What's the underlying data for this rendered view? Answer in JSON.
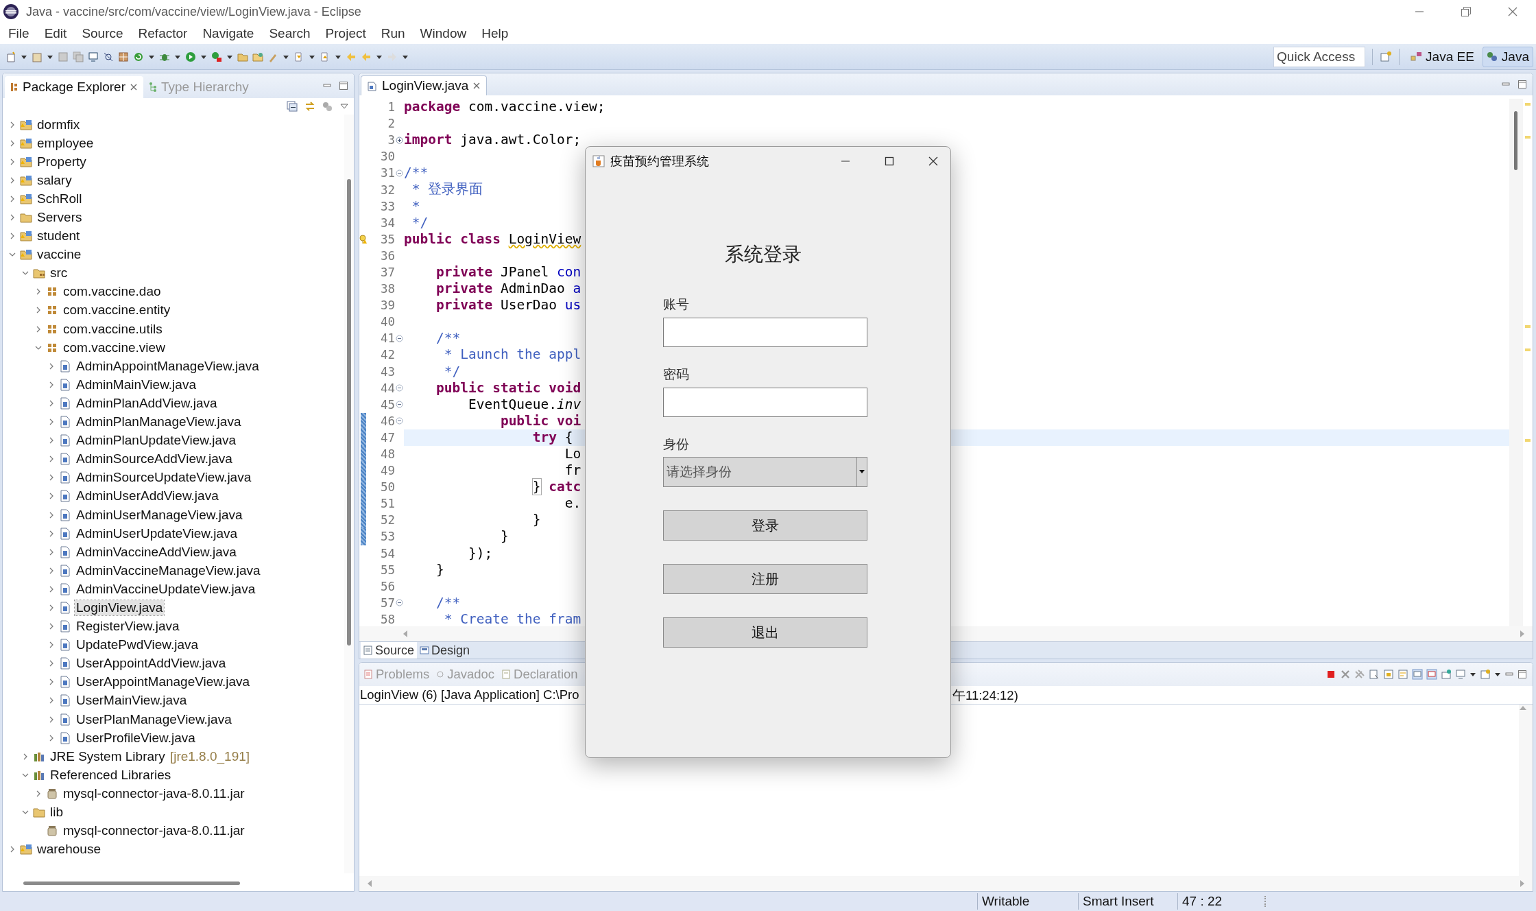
{
  "window": {
    "title": "Java - vaccine/src/com/vaccine/view/LoginView.java - Eclipse"
  },
  "menu": [
    "File",
    "Edit",
    "Source",
    "Refactor",
    "Navigate",
    "Search",
    "Project",
    "Run",
    "Window",
    "Help"
  ],
  "quick_access": {
    "placeholder": "Quick Access"
  },
  "perspectives": [
    {
      "label": "Java EE",
      "kind": "javaee",
      "selected": false
    },
    {
      "label": "Java",
      "kind": "java",
      "selected": true
    }
  ],
  "explorer": {
    "tabs": [
      {
        "label": "Package Explorer",
        "kind": "packages",
        "selected": true
      },
      {
        "label": "Type Hierarchy",
        "kind": "hierarchy",
        "selected": false
      }
    ],
    "tree": [
      {
        "label": "dormfix",
        "kind": "project",
        "expanded": false,
        "selected": false
      },
      {
        "label": "employee",
        "kind": "project",
        "expanded": false,
        "selected": false
      },
      {
        "label": "Property",
        "kind": "project",
        "expanded": false,
        "selected": false
      },
      {
        "label": "salary",
        "kind": "project",
        "expanded": false,
        "selected": false
      },
      {
        "label": "SchRoll",
        "kind": "project",
        "expanded": false,
        "selected": false
      },
      {
        "label": "Servers",
        "kind": "folder",
        "expanded": false,
        "selected": false
      },
      {
        "label": "student",
        "kind": "project",
        "expanded": false,
        "selected": false
      },
      {
        "label": "vaccine",
        "kind": "project",
        "expanded": true,
        "selected": false,
        "children": [
          {
            "label": "src",
            "kind": "source-folder",
            "expanded": true,
            "selected": false,
            "children": [
              {
                "label": "com.vaccine.dao",
                "kind": "package",
                "expanded": false,
                "selected": false
              },
              {
                "label": "com.vaccine.entity",
                "kind": "package",
                "expanded": false,
                "selected": false
              },
              {
                "label": "com.vaccine.utils",
                "kind": "package",
                "expanded": false,
                "selected": false
              },
              {
                "label": "com.vaccine.view",
                "kind": "package",
                "expanded": true,
                "selected": false,
                "children": [
                  {
                    "label": "AdminAppointManageView.java",
                    "kind": "java-file",
                    "expanded": false,
                    "selected": false
                  },
                  {
                    "label": "AdminMainView.java",
                    "kind": "java-file",
                    "expanded": false,
                    "selected": false
                  },
                  {
                    "label": "AdminPlanAddView.java",
                    "kind": "java-file",
                    "expanded": false,
                    "selected": false
                  },
                  {
                    "label": "AdminPlanManageView.java",
                    "kind": "java-file",
                    "expanded": false,
                    "selected": false
                  },
                  {
                    "label": "AdminPlanUpdateView.java",
                    "kind": "java-file",
                    "expanded": false,
                    "selected": false
                  },
                  {
                    "label": "AdminSourceAddView.java",
                    "kind": "java-file",
                    "expanded": false,
                    "selected": false
                  },
                  {
                    "label": "AdminSourceUpdateView.java",
                    "kind": "java-file",
                    "expanded": false,
                    "selected": false
                  },
                  {
                    "label": "AdminUserAddView.java",
                    "kind": "java-file",
                    "expanded": false,
                    "selected": false
                  },
                  {
                    "label": "AdminUserManageView.java",
                    "kind": "java-file",
                    "expanded": false,
                    "selected": false
                  },
                  {
                    "label": "AdminUserUpdateView.java",
                    "kind": "java-file",
                    "expanded": false,
                    "selected": false
                  },
                  {
                    "label": "AdminVaccineAddView.java",
                    "kind": "java-file",
                    "expanded": false,
                    "selected": false
                  },
                  {
                    "label": "AdminVaccineManageView.java",
                    "kind": "java-file",
                    "expanded": false,
                    "selected": false
                  },
                  {
                    "label": "AdminVaccineUpdateView.java",
                    "kind": "java-file",
                    "expanded": false,
                    "selected": false
                  },
                  {
                    "label": "LoginView.java",
                    "kind": "java-file",
                    "expanded": false,
                    "selected": true
                  },
                  {
                    "label": "RegisterView.java",
                    "kind": "java-file",
                    "expanded": false,
                    "selected": false
                  },
                  {
                    "label": "UpdatePwdView.java",
                    "kind": "java-file",
                    "expanded": false,
                    "selected": false
                  },
                  {
                    "label": "UserAppointAddView.java",
                    "kind": "java-file",
                    "expanded": false,
                    "selected": false
                  },
                  {
                    "label": "UserAppointManageView.java",
                    "kind": "java-file",
                    "expanded": false,
                    "selected": false
                  },
                  {
                    "label": "UserMainView.java",
                    "kind": "java-file",
                    "expanded": false,
                    "selected": false
                  },
                  {
                    "label": "UserPlanManageView.java",
                    "kind": "java-file",
                    "expanded": false,
                    "selected": false
                  },
                  {
                    "label": "UserProfileView.java",
                    "kind": "java-file",
                    "expanded": false,
                    "selected": false
                  }
                ]
              }
            ]
          },
          {
            "label": "JRE System Library",
            "decoration": "[jre1.8.0_191]",
            "kind": "library",
            "expanded": false,
            "selected": false
          },
          {
            "label": "Referenced Libraries",
            "kind": "library",
            "expanded": true,
            "selected": false,
            "children": [
              {
                "label": "mysql-connector-java-8.0.11.jar",
                "kind": "jar",
                "expanded": false,
                "selected": false
              }
            ]
          },
          {
            "label": "lib",
            "kind": "folder",
            "expanded": true,
            "selected": false,
            "children": [
              {
                "label": "mysql-connector-java-8.0.11.jar",
                "kind": "jar",
                "selected": false
              }
            ]
          }
        ]
      },
      {
        "label": "warehouse",
        "kind": "project",
        "expanded": false,
        "selected": false
      }
    ]
  },
  "editor": {
    "tabs": [
      {
        "label": "LoginView.java",
        "selected": true
      }
    ],
    "lines": [
      {
        "n": "1",
        "current": false,
        "in_range": false,
        "warning": false,
        "segments": [
          {
            "kind": "kw",
            "text": "package"
          },
          {
            "kind": "plain",
            "text": " com.vaccine.view;"
          }
        ]
      },
      {
        "n": "2",
        "current": false,
        "in_range": false,
        "warning": false
      },
      {
        "n": "3",
        "current": false,
        "in_range": false,
        "warning": false,
        "folded": true,
        "segments": [
          {
            "kind": "kw",
            "text": "import"
          },
          {
            "kind": "plain",
            "text": " java.awt.Color;"
          }
        ]
      },
      {
        "n": "30",
        "current": false,
        "in_range": false,
        "warning": false
      },
      {
        "n": "31",
        "current": false,
        "in_range": false,
        "warning": false,
        "folded": false,
        "segments": [
          {
            "kind": "comment",
            "text": "/**"
          }
        ]
      },
      {
        "n": "32",
        "current": false,
        "in_range": false,
        "warning": false,
        "segments": [
          {
            "kind": "comment",
            "text": " * 登录界面"
          }
        ]
      },
      {
        "n": "33",
        "current": false,
        "in_range": false,
        "warning": false,
        "segments": [
          {
            "kind": "comment",
            "text": " *"
          }
        ]
      },
      {
        "n": "34",
        "current": false,
        "in_range": false,
        "warning": false,
        "segments": [
          {
            "kind": "comment",
            "text": " */"
          }
        ]
      },
      {
        "n": "35",
        "current": false,
        "in_range": false,
        "warning": true,
        "segments": [
          {
            "kind": "kw",
            "text": "public class"
          },
          {
            "kind": "warn",
            "text": " LoginView"
          }
        ]
      },
      {
        "n": "36",
        "current": false,
        "in_range": false,
        "warning": false
      },
      {
        "n": "37",
        "current": false,
        "in_range": false,
        "warning": false,
        "segments": [
          {
            "kind": "kw",
            "text": "    private"
          },
          {
            "kind": "plain",
            "text": " JPanel "
          },
          {
            "kind": "field",
            "text": "con"
          }
        ]
      },
      {
        "n": "38",
        "current": false,
        "in_range": false,
        "warning": false,
        "segments": [
          {
            "kind": "kw",
            "text": "    private"
          },
          {
            "kind": "plain",
            "text": " AdminDao "
          },
          {
            "kind": "field",
            "text": "a"
          }
        ]
      },
      {
        "n": "39",
        "current": false,
        "in_range": false,
        "warning": false,
        "segments": [
          {
            "kind": "kw",
            "text": "    private"
          },
          {
            "kind": "plain",
            "text": " UserDao "
          },
          {
            "kind": "field",
            "text": "us"
          }
        ]
      },
      {
        "n": "40",
        "current": false,
        "in_range": false,
        "warning": false
      },
      {
        "n": "41",
        "current": false,
        "in_range": false,
        "warning": false,
        "folded": false,
        "segments": [
          {
            "kind": "comment",
            "text": "    /**"
          }
        ]
      },
      {
        "n": "42",
        "current": false,
        "in_range": false,
        "warning": false,
        "segments": [
          {
            "kind": "comment",
            "text": "     * Launch the appl"
          }
        ]
      },
      {
        "n": "43",
        "current": false,
        "in_range": false,
        "warning": false,
        "segments": [
          {
            "kind": "comment",
            "text": "     */"
          }
        ]
      },
      {
        "n": "44",
        "current": false,
        "in_range": false,
        "warning": false,
        "folded": false,
        "segments": [
          {
            "kind": "kw",
            "text": "    public static void"
          }
        ]
      },
      {
        "n": "45",
        "current": false,
        "in_range": false,
        "warning": false,
        "folded": false,
        "segments": [
          {
            "kind": "plain",
            "text": "        EventQueue."
          },
          {
            "kind": "italic",
            "text": "inv"
          }
        ]
      },
      {
        "n": "46",
        "current": false,
        "in_range": true,
        "warning": false,
        "folded": false,
        "segments": [
          {
            "kind": "kw",
            "text": "            public voi"
          }
        ]
      },
      {
        "n": "47",
        "current": true,
        "in_range": true,
        "warning": false,
        "segments": [
          {
            "kind": "kw",
            "text": "                try"
          },
          {
            "kind": "plain",
            "text": " {"
          }
        ]
      },
      {
        "n": "48",
        "current": false,
        "in_range": true,
        "warning": false,
        "segments": [
          {
            "kind": "plain",
            "text": "                    Lo"
          }
        ]
      },
      {
        "n": "49",
        "current": false,
        "in_range": true,
        "warning": false,
        "segments": [
          {
            "kind": "plain",
            "text": "                    fr"
          }
        ]
      },
      {
        "n": "50",
        "current": false,
        "in_range": true,
        "warning": false,
        "segments": [
          {
            "kind": "bracket",
            "text": "                }"
          },
          {
            "kind": "kw",
            "text": " catc"
          }
        ]
      },
      {
        "n": "51",
        "current": false,
        "in_range": true,
        "warning": false,
        "segments": [
          {
            "kind": "plain",
            "text": "                    e."
          }
        ]
      },
      {
        "n": "52",
        "current": false,
        "in_range": true,
        "warning": false,
        "segments": [
          {
            "kind": "plain",
            "text": "                }"
          }
        ]
      },
      {
        "n": "53",
        "current": false,
        "in_range": true,
        "warning": false,
        "segments": [
          {
            "kind": "plain",
            "text": "            }"
          }
        ]
      },
      {
        "n": "54",
        "current": false,
        "in_range": false,
        "warning": false,
        "segments": [
          {
            "kind": "plain",
            "text": "        });"
          }
        ]
      },
      {
        "n": "55",
        "current": false,
        "in_range": false,
        "warning": false,
        "segments": [
          {
            "kind": "plain",
            "text": "    }"
          }
        ]
      },
      {
        "n": "56",
        "current": false,
        "in_range": false,
        "warning": false
      },
      {
        "n": "57",
        "current": false,
        "in_range": false,
        "warning": false,
        "folded": false,
        "segments": [
          {
            "kind": "comment",
            "text": "    /**"
          }
        ]
      },
      {
        "n": "58",
        "current": false,
        "in_range": false,
        "warning": false,
        "segments": [
          {
            "kind": "comment",
            "text": "     * Create the fram"
          }
        ]
      }
    ],
    "bottom_tabs": [
      {
        "label": "Source",
        "kind": "source",
        "selected": true
      },
      {
        "label": "Design",
        "kind": "design",
        "selected": false
      }
    ]
  },
  "console": {
    "tabs": [
      {
        "label": "Problems",
        "kind": "problems",
        "selected": false
      },
      {
        "label": "Javadoc",
        "kind": "javadoc",
        "selected": false
      },
      {
        "label": "Declaration",
        "kind": "declaration",
        "selected": false
      }
    ],
    "line_left": "LoginView (6) [Java Application] C:\\Pro",
    "line_right": "午11:24:12)"
  },
  "dialog": {
    "title": "疫苗预约管理系统",
    "heading": "系统登录",
    "fields": [
      {
        "kind": "text",
        "label": "账号"
      },
      {
        "kind": "password",
        "label": "密码"
      },
      {
        "kind": "select",
        "label": "身份",
        "value": "请选择身份"
      }
    ],
    "buttons": [
      "登录",
      "注册",
      "退出"
    ]
  },
  "status_bar": {
    "items": [
      "Writable",
      "Smart Insert",
      "47 : 22"
    ]
  }
}
